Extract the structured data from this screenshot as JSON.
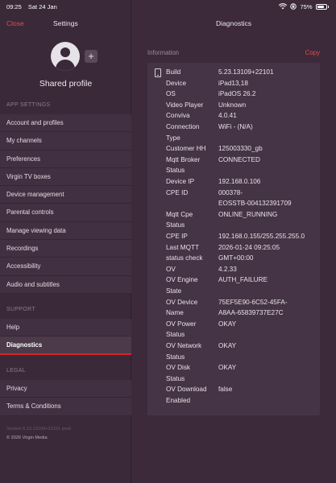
{
  "status_bar": {
    "time": "09:25",
    "date": "Sat 24 Jan",
    "battery": "75%"
  },
  "sidebar": {
    "close_label": "Close",
    "title": "Settings",
    "profile_name": "Shared profile",
    "app_settings_label": "APP SETTINGS",
    "app_settings_items": [
      "Account and profiles",
      "My channels",
      "Preferences",
      "Virgin TV boxes",
      "Device management",
      "Parental controls",
      "Manage viewing data",
      "Recordings",
      "Accessibility",
      "Audio and subtitles"
    ],
    "support_label": "SUPPORT",
    "support_items": [
      "Help",
      "Diagnostics"
    ],
    "active_item": "Diagnostics",
    "legal_label": "LEGAL",
    "legal_items": [
      "Privacy",
      "Terms & Conditions"
    ],
    "version": "Version 5.23.13109+22101 prod",
    "copyright": "© 2026 Virgin Media"
  },
  "main": {
    "title": "Diagnostics",
    "section_label": "Information",
    "copy_label": "Copy",
    "rows": [
      {
        "key": [
          "Build"
        ],
        "value": [
          "5.23.13109+22101"
        ]
      },
      {
        "key": [
          "Device"
        ],
        "value": [
          "iPad13,18"
        ]
      },
      {
        "key": [
          "OS"
        ],
        "value": [
          "iPadOS 26.2"
        ]
      },
      {
        "key": [
          "Video Player"
        ],
        "value": [
          "Unknown"
        ]
      },
      {
        "key": [
          "Conviva"
        ],
        "value": [
          "4.0.41"
        ]
      },
      {
        "key": [
          "Connection",
          "Type"
        ],
        "value": [
          "WiFi - (N/A)"
        ]
      },
      {
        "key": [
          "Customer HH"
        ],
        "value": [
          "125003330_gb"
        ]
      },
      {
        "key": [
          "Mqtt Broker",
          "Status"
        ],
        "value": [
          "CONNECTED"
        ]
      },
      {
        "key": [
          "Device IP"
        ],
        "value": [
          "192.168.0.106"
        ]
      },
      {
        "key": [
          "CPE ID"
        ],
        "value": [
          "000378-",
          "EOSSTB-004132391709"
        ]
      },
      {
        "key": [
          "Mqtt Cpe",
          "Status"
        ],
        "value": [
          "ONLINE_RUNNING"
        ]
      },
      {
        "key": [
          "CPE IP"
        ],
        "value": [
          "192.168.0.155/255.255.255.0"
        ]
      },
      {
        "key": [
          "Last MQTT",
          "status check"
        ],
        "value": [
          "2026-01-24 09:25:05",
          "GMT+00:00"
        ]
      },
      {
        "key": [
          "OV"
        ],
        "value": [
          "4.2.33"
        ]
      },
      {
        "key": [
          "OV Engine",
          "State"
        ],
        "value": [
          "AUTH_FAILURE"
        ]
      },
      {
        "key": [
          "OV Device",
          "Name"
        ],
        "value": [
          "75EF5E90-6C52-45FA-",
          "A8AA-65839737E27C"
        ]
      },
      {
        "key": [
          "OV Power",
          "Status"
        ],
        "value": [
          "OKAY"
        ]
      },
      {
        "key": [
          "OV Network",
          "Status"
        ],
        "value": [
          "OKAY"
        ]
      },
      {
        "key": [
          "OV Disk",
          "Status"
        ],
        "value": [
          "OKAY"
        ]
      },
      {
        "key": [
          "OV Download",
          "Enabled"
        ],
        "value": [
          "false"
        ]
      }
    ]
  },
  "colors": {
    "accent": "#e24a4a",
    "active_underline": "#d5242a",
    "background": "#3b2a3b"
  }
}
